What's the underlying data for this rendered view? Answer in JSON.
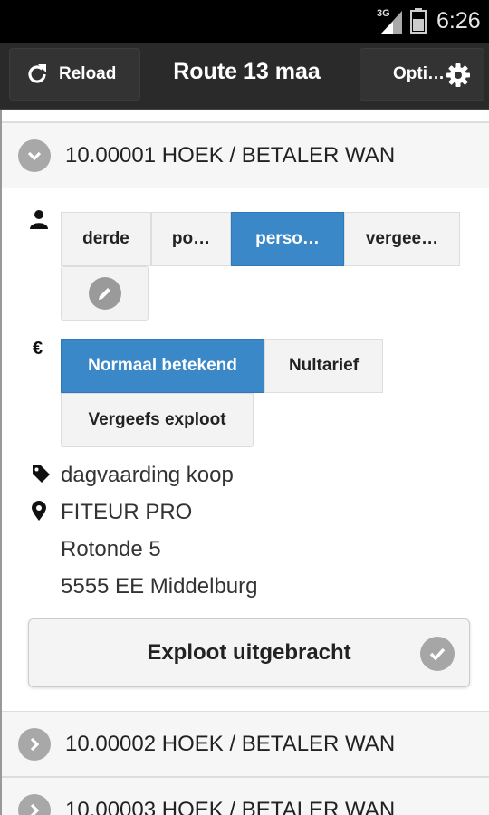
{
  "status_bar": {
    "network": "3G",
    "time": "6:26"
  },
  "header": {
    "reload_label": "Reload",
    "title": "Route 13 maa",
    "options_label": "Opti…"
  },
  "items": [
    {
      "title": "10.00001 HOEK / BETALER WAN",
      "expanded": true,
      "person_options": [
        "derde",
        "po…",
        "perso…",
        "vergee…"
      ],
      "person_selected": "perso…",
      "tariff_options": [
        "Normaal betekend",
        "Nultarief",
        "Vergeefs exploot"
      ],
      "tariff_selected": "Normaal betekend",
      "currency_symbol": "€",
      "document_type": "dagvaarding koop",
      "address": {
        "name": "FITEUR PRO",
        "street": "Rotonde 5",
        "city": "5555 EE Middelburg"
      },
      "done_label": "Exploot uitgebracht"
    },
    {
      "title": "10.00002 HOEK / BETALER WAN",
      "expanded": false
    },
    {
      "title": "10.00003 HOEK / BETALER WAN",
      "expanded": false
    }
  ],
  "colors": {
    "accent": "#3b88c8",
    "header_bg": "#2a2a2a",
    "status_bar_bg": "#000000"
  },
  "icons": {
    "reload": "reload-icon",
    "options": "gear-icon",
    "expand": "chevron-down-icon",
    "collapse": "chevron-right-icon",
    "person": "person-icon",
    "edit": "pencil-icon",
    "tag": "tag-icon",
    "location": "map-pin-icon",
    "check": "check-icon"
  }
}
